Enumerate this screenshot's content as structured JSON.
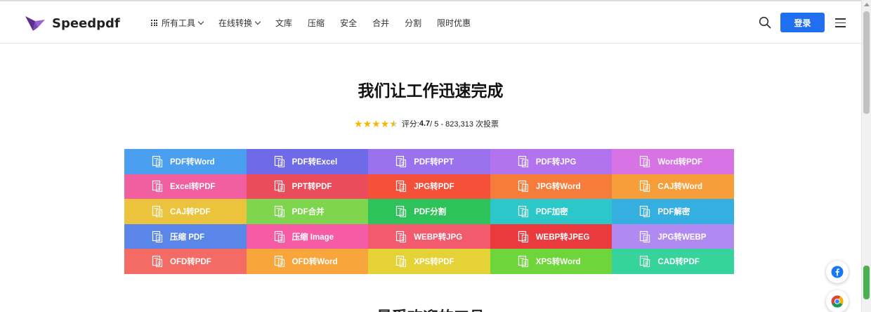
{
  "brand": {
    "name": "Speedpdf",
    "color": "#6b3fa0"
  },
  "nav": [
    {
      "label": "所有工具",
      "icon": "grid-icon",
      "dropdown": true
    },
    {
      "label": "在线转换",
      "dropdown": true
    },
    {
      "label": "文库"
    },
    {
      "label": "压缩"
    },
    {
      "label": "安全"
    },
    {
      "label": "合并"
    },
    {
      "label": "分割"
    },
    {
      "label": "限时优惠"
    }
  ],
  "header": {
    "login_label": "登录",
    "accent": "#1f6ff0"
  },
  "hero": {
    "title": "我们让工作迅速完成",
    "rating_prefix": "评分: ",
    "rating_value": "4.7",
    "rating_suffix": " / 5 - 823,313 次投票",
    "stars": 4.5
  },
  "tools": [
    {
      "label": "PDF转Word",
      "color": "#4a9ff0",
      "icon": "pdf-to-word-icon"
    },
    {
      "label": "PDF转Excel",
      "color": "#6e6ae8",
      "icon": "pdf-to-excel-icon"
    },
    {
      "label": "PDF转PPT",
      "color": "#9b72ee",
      "icon": "pdf-to-ppt-icon"
    },
    {
      "label": "PDF转JPG",
      "color": "#b274ee",
      "icon": "pdf-to-jpg-icon"
    },
    {
      "label": "Word转PDF",
      "color": "#d873e6",
      "icon": "word-to-pdf-icon"
    },
    {
      "label": "Excel转PDF",
      "color": "#f25fa0",
      "icon": "excel-to-pdf-icon"
    },
    {
      "label": "PPT转PDF",
      "color": "#ea4c5c",
      "icon": "ppt-to-pdf-icon"
    },
    {
      "label": "JPG转PDF",
      "color": "#f5503a",
      "icon": "jpg-to-pdf-icon"
    },
    {
      "label": "JPG转Word",
      "color": "#f57c3a",
      "icon": "jpg-to-word-icon"
    },
    {
      "label": "CAJ转Word",
      "color": "#f59e3a",
      "icon": "caj-to-word-icon"
    },
    {
      "label": "CAJ转PDF",
      "color": "#ecc33c",
      "icon": "caj-to-pdf-icon"
    },
    {
      "label": "PDF合并",
      "color": "#7dd64e",
      "icon": "merge-pdf-icon"
    },
    {
      "label": "PDF分割",
      "color": "#2ec25a",
      "icon": "split-pdf-icon"
    },
    {
      "label": "PDF加密",
      "color": "#2cc7c9",
      "icon": "lock-pdf-icon"
    },
    {
      "label": "PDF解密",
      "color": "#35aee0",
      "icon": "unlock-pdf-icon"
    },
    {
      "label": "压缩 PDF",
      "color": "#5a86ea",
      "icon": "compress-pdf-icon"
    },
    {
      "label": "压缩 Image",
      "color": "#f55ca5",
      "icon": "compress-image-icon"
    },
    {
      "label": "WEBP转JPG",
      "color": "#f25a6e",
      "icon": "webp-to-jpg-icon"
    },
    {
      "label": "WEBP转JPEG",
      "color": "#ea3a3e",
      "icon": "webp-to-jpeg-icon"
    },
    {
      "label": "JPG转WEBP",
      "color": "#b08af0",
      "icon": "jpg-to-webp-icon"
    },
    {
      "label": "OFD转PDF",
      "color": "#f46a64",
      "icon": "ofd-to-pdf-icon"
    },
    {
      "label": "OFD转Word",
      "color": "#f8a63c",
      "icon": "ofd-to-word-icon"
    },
    {
      "label": "XPS转PDF",
      "color": "#e4d236",
      "icon": "xps-to-pdf-icon"
    },
    {
      "label": "XPS转Word",
      "color": "#6ed63a",
      "icon": "xps-to-word-icon"
    },
    {
      "label": "CAD转PDF",
      "color": "#36d49c",
      "icon": "cad-to-pdf-icon"
    }
  ],
  "next_section_title": "最受欢迎的工具"
}
